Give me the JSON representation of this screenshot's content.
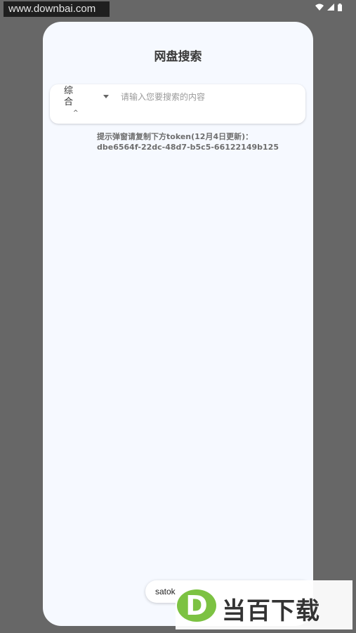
{
  "watermark_top": "www.downbai.com",
  "status_bar": {
    "icons": [
      "wifi-icon",
      "signal-icon",
      "battery-icon"
    ]
  },
  "header": {
    "title": "网盘搜索"
  },
  "search": {
    "category": "综合",
    "caret": "^",
    "placeholder": "请输入您要搜索的内容",
    "value": ""
  },
  "tip": {
    "line1": "提示弹窗请复制下方token(12月4日更新)：",
    "line2": "dbe6564f-22dc-48d7-b5c5-66122149b125"
  },
  "toast": {
    "text": "satok"
  },
  "logo_watermark": {
    "letter": "D",
    "text": "当百下载",
    "color": "#7cc242"
  },
  "colors": {
    "panel": "#f6f9ff",
    "backdrop": "#676767"
  }
}
